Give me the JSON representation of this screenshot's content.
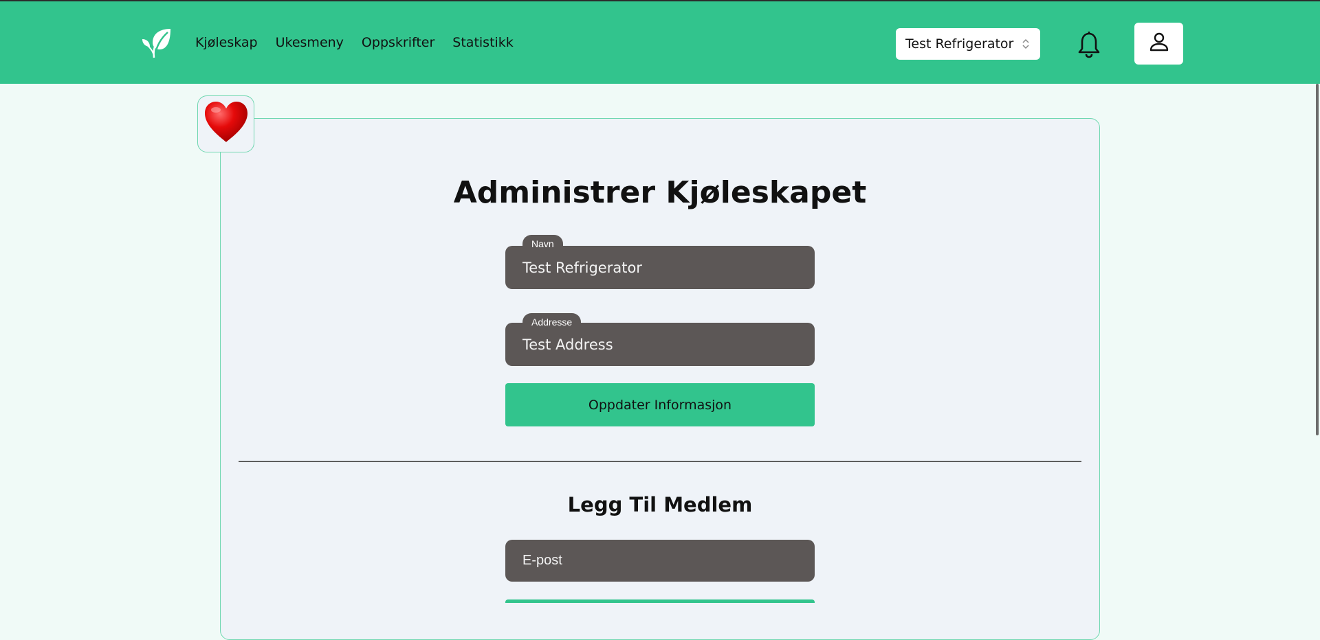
{
  "nav": {
    "items": [
      {
        "label": "Kjøleskap"
      },
      {
        "label": "Ukesmeny"
      },
      {
        "label": "Oppskrifter"
      },
      {
        "label": "Statistikk"
      }
    ],
    "fridge_select": {
      "value": "Test Refrigerator"
    },
    "icons": {
      "logo": "leaf-icon",
      "notifications": "bell-icon",
      "profile": "user-icon"
    }
  },
  "manage": {
    "badge_icon": "heart-icon",
    "title": "Administrer Kjøleskapet",
    "name_field": {
      "label": "Navn",
      "value": "Test Refrigerator"
    },
    "address_field": {
      "label": "Addresse",
      "value": "Test Address"
    },
    "update_button": "Oppdater Informasjon"
  },
  "add_member": {
    "title": "Legg Til Medlem",
    "email_field": {
      "placeholder": "E-post"
    }
  },
  "colors": {
    "brand": "#32c48d",
    "field_bg": "#5c5756",
    "card_bg": "#eff3f8",
    "page_bg": "#f0faf7"
  }
}
